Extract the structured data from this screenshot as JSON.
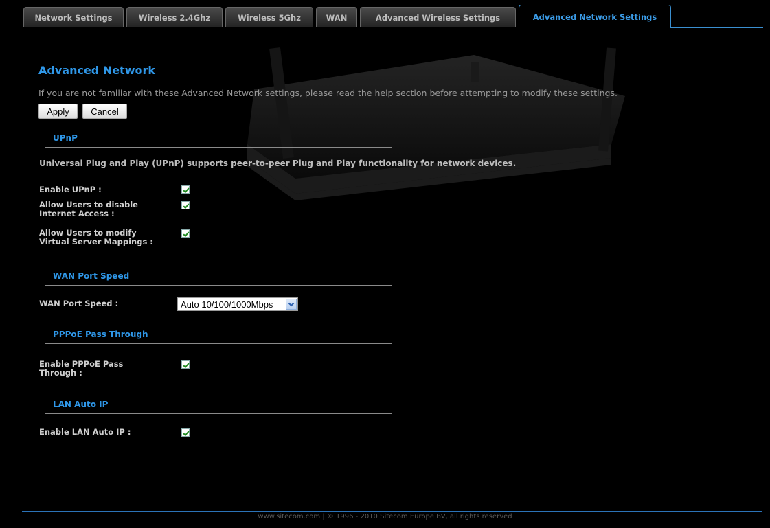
{
  "tabs": [
    {
      "label": "Network Settings"
    },
    {
      "label": "Wireless 2.4Ghz"
    },
    {
      "label": "Wireless 5Ghz"
    },
    {
      "label": "WAN"
    },
    {
      "label": "Advanced Wireless Settings"
    },
    {
      "label": "Advanced Network Settings",
      "active": true
    }
  ],
  "page": {
    "title": "Advanced Network",
    "intro": "If you are not familiar with these Advanced Network settings, please read the help section before attempting to modify these settings.",
    "apply_label": "Apply",
    "cancel_label": "Cancel"
  },
  "upnp": {
    "heading": "UPnP",
    "description": "Universal Plug and Play (UPnP) supports peer-to-peer Plug and Play functionality for network devices.",
    "enable_label": "Enable UPnP :",
    "enable_checked": true,
    "disable_access_label_1": "Allow Users to disable",
    "disable_access_label_2": "Internet Access :",
    "disable_access_checked": true,
    "modify_mappings_label_1": "Allow Users to modify",
    "modify_mappings_label_2": "Virtual Server Mappings :",
    "modify_mappings_checked": true
  },
  "wan_port_speed": {
    "heading": "WAN Port Speed",
    "label": "WAN Port Speed :",
    "selected": "Auto 10/100/1000Mbps"
  },
  "pppoe": {
    "heading": "PPPoE Pass Through",
    "label_1": "Enable PPPoE Pass",
    "label_2": "Through :",
    "checked": true
  },
  "lan_auto_ip": {
    "heading": "LAN Auto IP",
    "label": "Enable LAN Auto IP :",
    "checked": true
  },
  "footer": {
    "text": "www.sitecom.com | © 1996 - 2010 Sitecom Europe BV, all rights reserved"
  },
  "colors": {
    "accent": "#2f97e8",
    "background": "#000000"
  }
}
